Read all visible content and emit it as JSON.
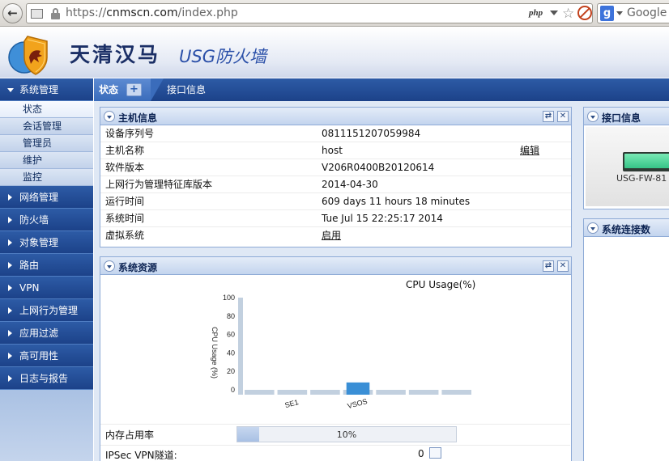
{
  "browser": {
    "url_scheme": "https://",
    "url_host": "cnmscn.com",
    "url_path": "/index.php",
    "php_badge": "php",
    "search_placeholder": "Google"
  },
  "header": {
    "company": "天清汉马",
    "product": "USG防火墙"
  },
  "sidebar": {
    "open_group": "系统管理",
    "sub_items": [
      "状态",
      "会话管理",
      "管理员",
      "维护",
      "监控"
    ],
    "groups": [
      "网络管理",
      "防火墙",
      "对象管理",
      "路由",
      "VPN",
      "上网行为管理",
      "应用过滤",
      "高可用性",
      "日志与报告"
    ]
  },
  "tabs": {
    "active": "状态",
    "other": "接口信息"
  },
  "host_info": {
    "title": "主机信息",
    "rows": [
      {
        "label": "设备序列号",
        "value": "0811151207059984"
      },
      {
        "label": "主机名称",
        "value": "host",
        "action": "编辑"
      },
      {
        "label": "软件版本",
        "value": "V206R0400B20120614"
      },
      {
        "label": "上网行为管理特征库版本",
        "value": "2014-04-30"
      },
      {
        "label": "运行时间",
        "value": "609 days 11 hours 18 minutes"
      },
      {
        "label": "系统时间",
        "value": "Tue Jul 15 22:25:17 2014"
      },
      {
        "label": "虚拟系统",
        "value": "启用"
      }
    ]
  },
  "resources": {
    "title": "系统资源",
    "memory_label": "内存占用率",
    "memory_percent": 10,
    "memory_text": "10%",
    "ipsec_label": "IPSec VPN隧道:",
    "ipsec_value": "0"
  },
  "interface_panel": {
    "title": "接口信息",
    "device": "USG-FW-81"
  },
  "connections_panel": {
    "title": "系统连接数"
  },
  "chart_data": {
    "type": "bar",
    "title": "CPU Usage(%)",
    "ylabel": "CPU Usage (%)",
    "xlabel": "",
    "categories": [
      "",
      "SE1",
      "",
      "VSOS",
      "",
      "",
      ""
    ],
    "values": [
      0,
      0,
      0,
      8,
      0,
      0,
      0
    ],
    "max_bar": 100,
    "ylim": [
      0,
      100
    ],
    "yticks": [
      0,
      20,
      40,
      60,
      80,
      100
    ],
    "colors": {
      "bar": "#3a8fd6",
      "track": "#c2d0df"
    }
  }
}
